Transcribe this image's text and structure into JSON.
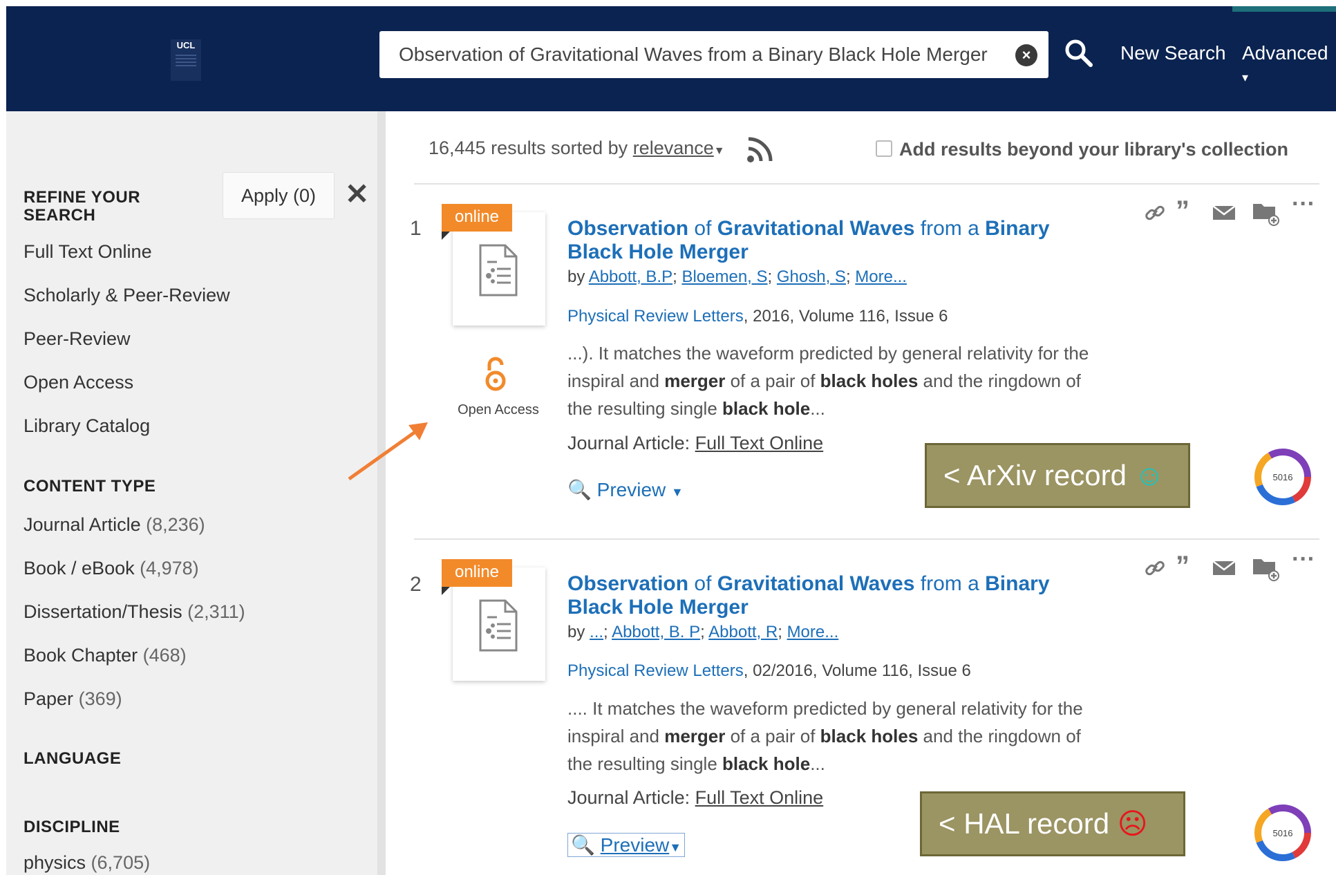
{
  "header": {
    "logo_text": "UCL",
    "search_value": "Observation of Gravitational Waves from a Binary Black Hole Merger",
    "new_search": "New Search",
    "advanced": "Advanced"
  },
  "sidebar": {
    "refine_title_1": "REFINE YOUR",
    "refine_title_2": "SEARCH",
    "apply": "Apply (0)",
    "refine_items": [
      "Full Text Online",
      "Scholarly & Peer-Review",
      "Peer-Review",
      "Open Access",
      "Library Catalog"
    ],
    "content_type_title": "CONTENT TYPE",
    "content_types": [
      {
        "label": "Journal Article",
        "count": "(8,236)"
      },
      {
        "label": "Book / eBook",
        "count": "(4,978)"
      },
      {
        "label": "Dissertation/Thesis",
        "count": "(2,311)"
      },
      {
        "label": "Book Chapter",
        "count": "(468)"
      },
      {
        "label": "Paper",
        "count": "(369)"
      }
    ],
    "language_title": "LANGUAGE",
    "discipline_title": "DISCIPLINE",
    "disciplines": [
      {
        "label": "physics",
        "count": "(6,705)"
      }
    ]
  },
  "results": {
    "count_text": "16,445 results sorted by",
    "sort_label": "relevance",
    "beyond_label": "Add results beyond your library's collection"
  },
  "records": [
    {
      "number": "1",
      "badge": "online",
      "title_line1_a": "Observation",
      "title_line1_b": " of ",
      "title_line1_c": "Gravitational Waves",
      "title_line1_d": " from a ",
      "title_line1_e": "Binary",
      "title_line2": "Black Hole Merger",
      "by": "by",
      "authors": [
        "Abbott, B.P",
        "Bloemen, S",
        "Ghosh, S",
        "More..."
      ],
      "journal": "Physical Review Letters",
      "pub_details": ", 2016, Volume 116, Issue 6",
      "snippet_1": "...). It matches the waveform predicted by general relativity for the",
      "snippet_2a": "inspiral and ",
      "snippet_2b": "merger",
      "snippet_2c": " of a pair of ",
      "snippet_2d": "black holes",
      "snippet_2e": " and the ringdown of",
      "snippet_3a": "the resulting single ",
      "snippet_3b": "black hole",
      "snippet_3c": "...",
      "type_label": "Journal Article: ",
      "type_link": "Full Text Online",
      "preview": "Preview",
      "open_access": "Open Access",
      "annotation": "< ArXiv record ",
      "annotation_emoji": "☺",
      "altmetric": "5016"
    },
    {
      "number": "2",
      "badge": "online",
      "title_line1_a": "Observation",
      "title_line1_b": " of ",
      "title_line1_c": "Gravitational Waves",
      "title_line1_d": " from a ",
      "title_line1_e": "Binary",
      "title_line2": "Black Hole Merger",
      "by": "by",
      "authors": [
        "...",
        "Abbott, B. P",
        "Abbott, R",
        "More..."
      ],
      "journal": "Physical Review Letters",
      "pub_details": ", 02/2016, Volume 116, Issue 6",
      "snippet_1": ".... It matches the waveform predicted by general relativity for the",
      "snippet_2a": "inspiral and ",
      "snippet_2b": "merger",
      "snippet_2c": " of a pair of ",
      "snippet_2d": "black holes",
      "snippet_2e": " and the ringdown of",
      "snippet_3a": "the resulting single ",
      "snippet_3b": "black hole",
      "snippet_3c": "...",
      "type_label": "Journal Article: ",
      "type_link": "Full Text Online",
      "preview": "Preview",
      "annotation": "< HAL record ",
      "annotation_emoji": "☹",
      "altmetric": "5016"
    }
  ],
  "colors": {
    "header_bg": "#0b2350",
    "link": "#1d6fb8",
    "badge": "#f28a2a",
    "annotation_bg": "#9b9463",
    "arrow": "#f07f35"
  }
}
